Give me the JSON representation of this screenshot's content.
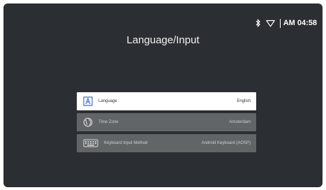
{
  "status": {
    "icons": [
      "bluetooth-icon",
      "wifi-icon"
    ],
    "time": "AM 04:58"
  },
  "page": {
    "title": "Language/Input"
  },
  "menu": {
    "items": [
      {
        "label": "Language",
        "value": "English",
        "icon": "language-icon",
        "selected": true
      },
      {
        "label": "Time Zone",
        "value": "Amsterdam",
        "icon": "globe-icon",
        "selected": false
      },
      {
        "label": "Keyboard Input Method",
        "value": "Android Keyboard (AOSP)",
        "icon": "keyboard-icon",
        "selected": false
      }
    ]
  },
  "colors": {
    "background": "#2b2e32",
    "selected_item": "#ffffff",
    "item": "#626567",
    "accent": "#3b6fd6"
  }
}
